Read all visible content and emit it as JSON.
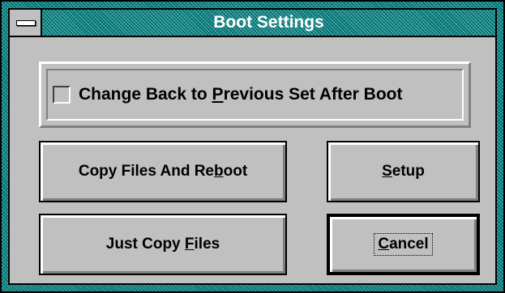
{
  "window": {
    "title": "Boot Settings",
    "system_menu_icon": "system-menu-icon"
  },
  "options": {
    "change_back": {
      "label_before": "Change Back to ",
      "label_accel": "P",
      "label_after": "revious Set After Boot",
      "checked": false
    }
  },
  "buttons": {
    "copy_reboot": {
      "before": "Copy Files And Re",
      "accel": "b",
      "after": "oot"
    },
    "setup": {
      "before": "",
      "accel": "S",
      "after": "etup"
    },
    "copy_files": {
      "before": "Just Copy ",
      "accel": "F",
      "after": "iles"
    },
    "cancel": {
      "before": "",
      "accel": "C",
      "after": "ancel"
    }
  }
}
